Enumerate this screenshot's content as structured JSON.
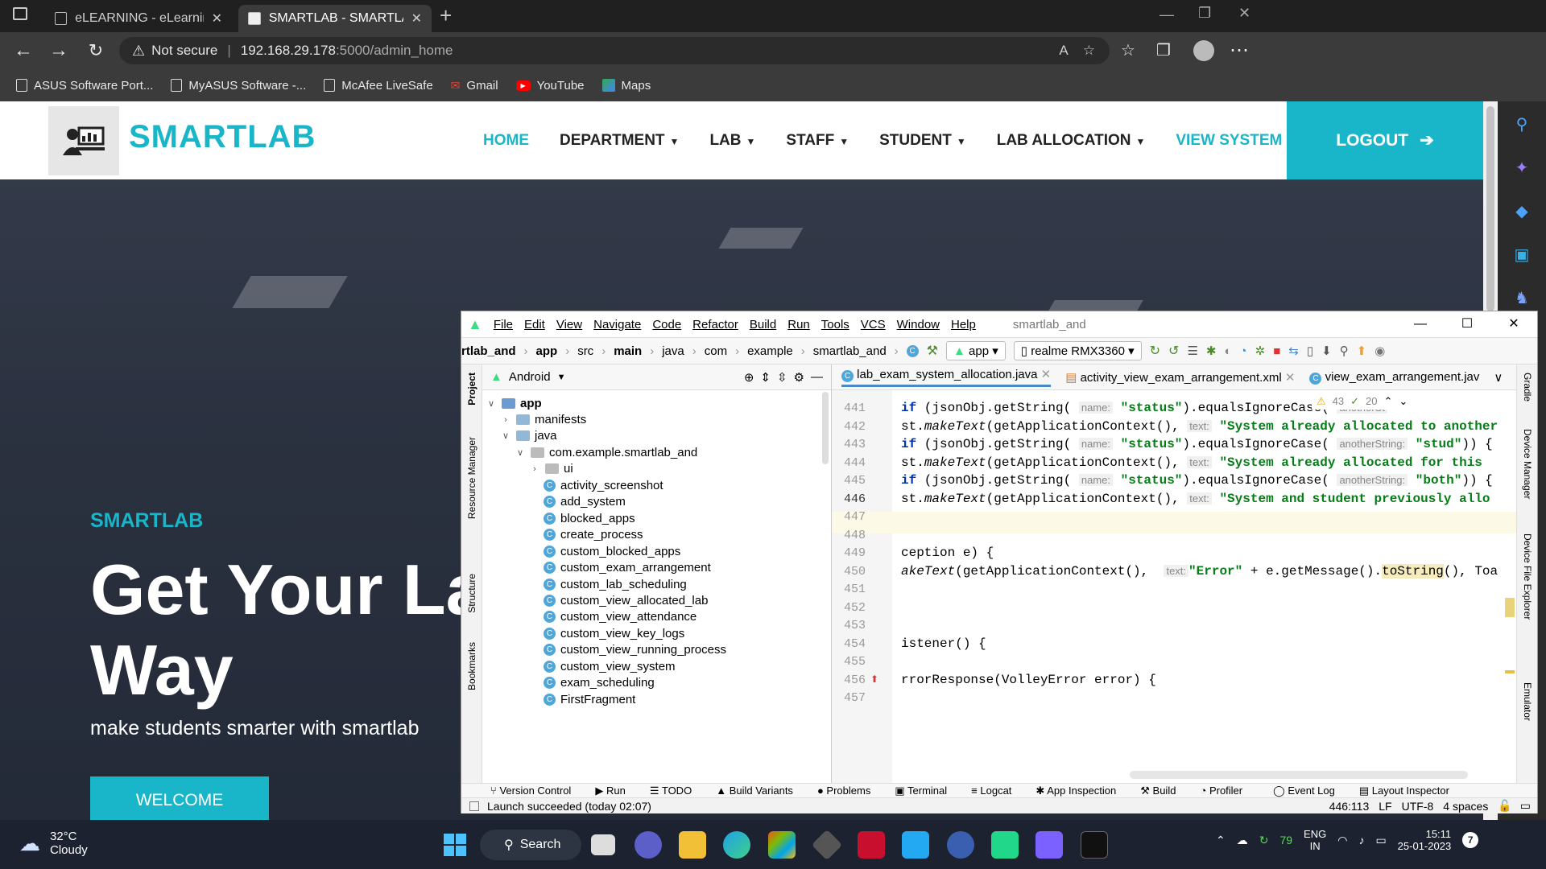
{
  "browser": {
    "tabs": [
      {
        "title": "eLEARNING - eLearning HTML Te",
        "active": false
      },
      {
        "title": "SMARTLAB - SMARTLAB HTML Te",
        "active": true
      }
    ],
    "security": "Not secure",
    "url_host": "192.168.29.178",
    "url_path": ":5000/admin_home",
    "bookmarks": [
      "ASUS Software Port...",
      "MyASUS Software -...",
      "McAfee LiveSafe",
      "Gmail",
      "YouTube",
      "Maps"
    ]
  },
  "site": {
    "brand": "SMARTLAB",
    "nav": [
      {
        "label": "HOME",
        "dropdown": false,
        "active": true
      },
      {
        "label": "DEPARTMENT",
        "dropdown": true,
        "active": false
      },
      {
        "label": "LAB",
        "dropdown": true,
        "active": false
      },
      {
        "label": "STAFF",
        "dropdown": true,
        "active": false
      },
      {
        "label": "STUDENT",
        "dropdown": true,
        "active": false
      },
      {
        "label": "LAB ALLOCATION",
        "dropdown": true,
        "active": false
      },
      {
        "label": "VIEW SYSTEM",
        "dropdown": false,
        "active": true
      }
    ],
    "logout": "LOGOUT",
    "hero_sub": "SMARTLAB",
    "hero_title": "Get Your Lab Way",
    "hero_title_line1": "Get Your Lab",
    "hero_title_line2": "Way",
    "hero_desc": "make students smarter with smartlab",
    "hero_button": "WELCOME",
    "accent": "#19b5c9"
  },
  "ide": {
    "menu": [
      "File",
      "Edit",
      "View",
      "Navigate",
      "Code",
      "Refactor",
      "Build",
      "Run",
      "Tools",
      "VCS",
      "Window",
      "Help"
    ],
    "project_name": "smartlab_and",
    "breadcrumb": [
      "rtlab_and",
      "app",
      "src",
      "main",
      "java",
      "com",
      "example",
      "smartlab_and"
    ],
    "run_config": "app",
    "device": "realme RMX3360",
    "project_view": "Android",
    "tree": [
      {
        "label": "app",
        "type": "module",
        "level": 0,
        "open": true
      },
      {
        "label": "manifests",
        "type": "folder",
        "level": 1,
        "open": false
      },
      {
        "label": "java",
        "type": "folder",
        "level": 1,
        "open": true
      },
      {
        "label": "com.example.smartlab_and",
        "type": "package",
        "level": 2,
        "open": true
      },
      {
        "label": "ui",
        "type": "package",
        "level": 3,
        "open": false
      },
      {
        "label": "activity_screenshot",
        "type": "class",
        "level": 3
      },
      {
        "label": "add_system",
        "type": "class",
        "level": 3
      },
      {
        "label": "blocked_apps",
        "type": "class",
        "level": 3
      },
      {
        "label": "create_process",
        "type": "class",
        "level": 3
      },
      {
        "label": "custom_blocked_apps",
        "type": "class",
        "level": 3
      },
      {
        "label": "custom_exam_arrangement",
        "type": "class",
        "level": 3
      },
      {
        "label": "custom_lab_scheduling",
        "type": "class",
        "level": 3
      },
      {
        "label": "custom_view_allocated_lab",
        "type": "class",
        "level": 3
      },
      {
        "label": "custom_view_attendance",
        "type": "class",
        "level": 3
      },
      {
        "label": "custom_view_key_logs",
        "type": "class",
        "level": 3
      },
      {
        "label": "custom_view_running_process",
        "type": "class",
        "level": 3
      },
      {
        "label": "custom_view_system",
        "type": "class",
        "level": 3
      },
      {
        "label": "exam_scheduling",
        "type": "class",
        "level": 3
      },
      {
        "label": "FirstFragment",
        "type": "class",
        "level": 3
      }
    ],
    "editor_tabs": [
      "lab_exam_system_allocation.java",
      "activity_view_exam_arrangement.xml",
      "view_exam_arrangement.jav"
    ],
    "inspections": {
      "warnings": "43",
      "weak": "20"
    },
    "lines": [
      "441",
      "442",
      "443",
      "444",
      "445",
      "446",
      "447",
      "448",
      "449",
      "450",
      "451",
      "452",
      "453",
      "454",
      "455",
      "456",
      "457"
    ],
    "code": {
      "l441a": "if",
      "l441b": " (jsonObj.getString(",
      "l441h": "name:",
      "l441s": "\"status\"",
      "l441c": ").equalsIgnoreCase(",
      "l441h2": "anotherSt",
      "l442a": "st.",
      "l442b": "makeText",
      "l442c": "(getApplicationContext(), ",
      "l442h": "text:",
      "l442s": "\"System already allocated to another",
      "l443a": "if",
      "l443b": " (jsonObj.getString(",
      "l443h": "name:",
      "l443s": "\"status\"",
      "l443c": ").equalsIgnoreCase(",
      "l443h2": "anotherString:",
      "l443s2": "\"stud\"",
      "l443d": ")) {",
      "l444a": "st.",
      "l444b": "makeText",
      "l444c": "(getApplicationContext(), ",
      "l444h": "text:",
      "l444s": "\"System already allocated for this",
      "l445a": "if",
      "l445b": " (jsonObj.getString(",
      "l445h": "name:",
      "l445s": "\"status\"",
      "l445c": ").equalsIgnoreCase(",
      "l445h2": "anotherString:",
      "l445s2": "\"both\"",
      "l445d": ")) {",
      "l446a": "st.",
      "l446b": "makeText",
      "l446c": "(getApplicationContext(), ",
      "l446h": "text:",
      "l446s": "\"System and student previously allo",
      "l449": "ception e) {",
      "l450a": "akeText",
      "l450b": "(getApplicationContext(), ",
      "l450h": "text:",
      "l450s": "\"Error\"",
      "l450c": " + e.getMessage().",
      "l450d": "toString",
      "l450e": "(), Toa",
      "l454": "istener() {",
      "l456": "rrorResponse(VolleyError error) {"
    },
    "left_tools": [
      "Project",
      "Resource Manager",
      "Structure",
      "Bookmarks"
    ],
    "right_tools": [
      "Gradle",
      "Device Manager",
      "Device File Explorer",
      "Emulator"
    ],
    "tool_windows": [
      "Version Control",
      "Run",
      "TODO",
      "Build Variants",
      "Problems",
      "Terminal",
      "Logcat",
      "App Inspection",
      "Build",
      "Profiler",
      "Event Log",
      "Layout Inspector"
    ],
    "status_message": "Launch succeeded (today 02:07)",
    "cursor_pos": "446:113",
    "line_sep": "LF",
    "encoding": "UTF-8",
    "indent": "4 spaces"
  },
  "taskbar": {
    "temp": "32°C",
    "weather": "Cloudy",
    "search": "Search",
    "battery": "79",
    "lang": "ENG",
    "region": "IN",
    "time": "15:11",
    "date": "25-01-2023",
    "notifications": "7"
  }
}
